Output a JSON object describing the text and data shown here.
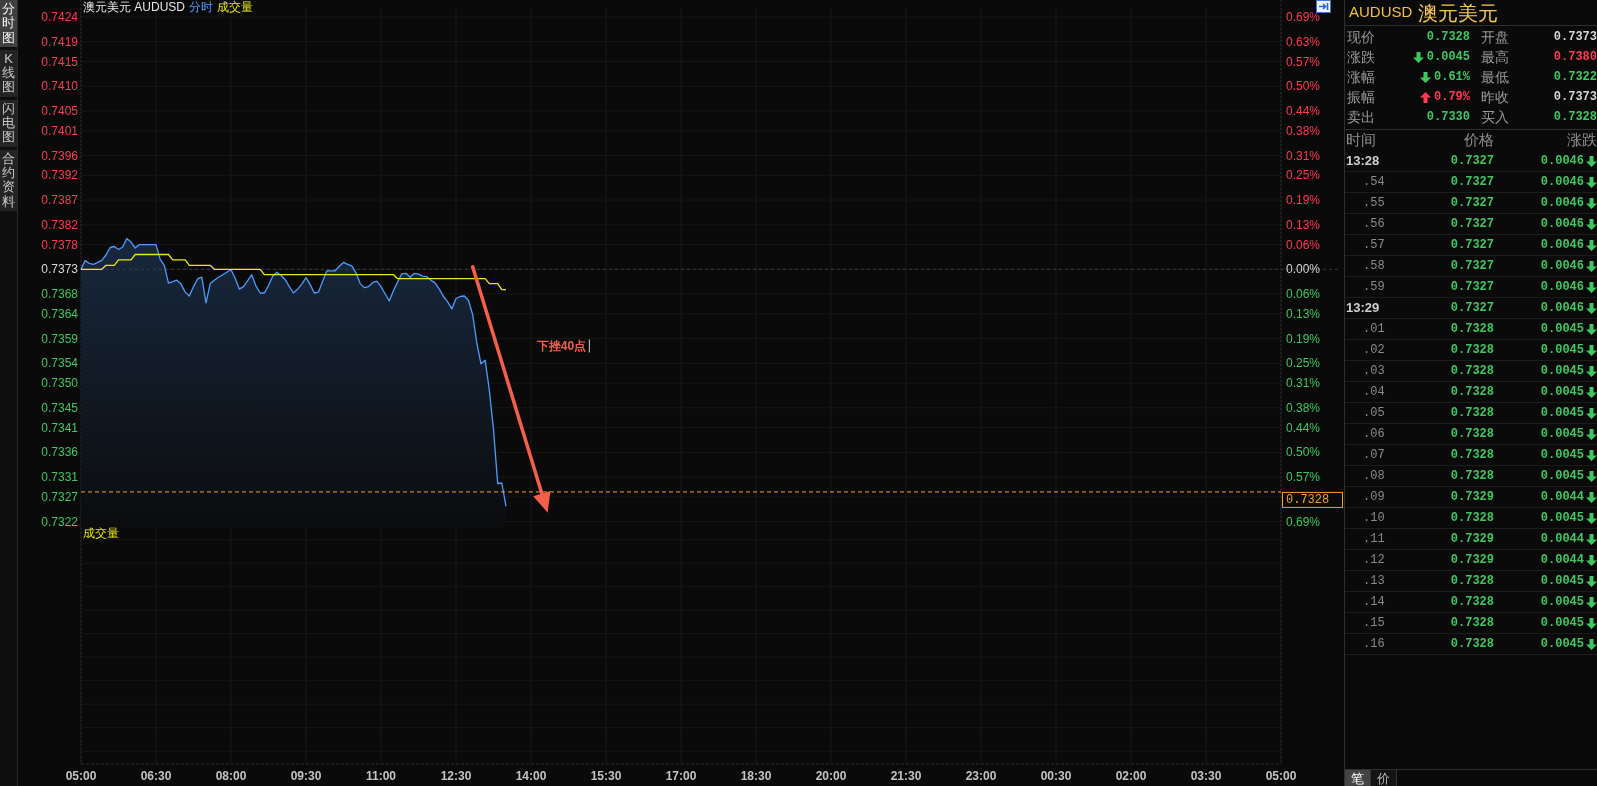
{
  "side_tabs": [
    {
      "label": "分时图",
      "selected": true
    },
    {
      "label": "K线图",
      "selected": false
    },
    {
      "label": "闪电图",
      "selected": false
    },
    {
      "label": "合约资料",
      "selected": false
    }
  ],
  "chart": {
    "chart_data": {
      "type": "line",
      "title": "澳元美元 AUDUSD",
      "grid": true,
      "categories": [
        "05:00",
        null,
        null,
        null,
        null,
        null,
        null,
        null,
        null,
        null,
        null,
        null,
        null,
        null,
        null,
        null,
        null,
        null,
        "06:30",
        null,
        null,
        null,
        null,
        null,
        null,
        null,
        null,
        null,
        null,
        null,
        null,
        null,
        null,
        null,
        null,
        null,
        "08:00",
        null,
        null,
        null,
        null,
        null,
        null,
        null,
        null,
        null,
        null,
        null,
        null,
        null,
        null,
        null,
        null,
        null,
        "09:30",
        null,
        null,
        null,
        null,
        null,
        null,
        null,
        null,
        null,
        null,
        null,
        null,
        null,
        null,
        null,
        null,
        null,
        "11:00",
        null,
        null,
        null,
        null,
        null,
        null,
        null,
        null,
        null,
        null,
        null,
        null,
        null,
        null,
        null,
        null,
        null,
        "12:30",
        null,
        null,
        null,
        null,
        null,
        null,
        null,
        null,
        null,
        null,
        null,
        null,
        null,
        null,
        null,
        null,
        null,
        "14:00",
        null,
        null,
        null,
        null,
        null,
        null,
        null,
        null,
        null,
        null,
        null,
        null,
        null,
        null,
        null,
        null,
        null,
        "15:30",
        null,
        null,
        null,
        null,
        null,
        null,
        null,
        null,
        null,
        null,
        null,
        null,
        null,
        null,
        null,
        null,
        null,
        "17:00",
        null,
        null,
        null,
        null,
        null,
        null,
        null,
        null,
        null,
        null,
        null,
        null,
        null,
        null,
        null,
        null,
        null,
        "18:30",
        null,
        null,
        null,
        null,
        null,
        null,
        null,
        null,
        null,
        null,
        null,
        null,
        null,
        null,
        null,
        null,
        null,
        "20:00",
        null,
        null,
        null,
        null,
        null,
        null,
        null,
        null,
        null,
        null,
        null,
        null,
        null,
        null,
        null,
        null,
        null,
        "21:30",
        null,
        null,
        null,
        null,
        null,
        null,
        null,
        null,
        null,
        null,
        null,
        null,
        null,
        null,
        null,
        null,
        null,
        "23:00",
        null,
        null,
        null,
        null,
        null,
        null,
        null,
        null,
        null,
        null,
        null,
        null,
        null,
        null,
        null,
        null,
        null,
        "00:30",
        null,
        null,
        null,
        null,
        null,
        null,
        null,
        null,
        null,
        null,
        null,
        null,
        null,
        null,
        null,
        null,
        null,
        "02:00",
        null,
        null,
        null,
        null,
        null,
        null,
        null,
        null,
        null,
        null,
        null,
        null,
        null,
        null,
        null,
        null,
        null,
        "03:30",
        null,
        null,
        null,
        null,
        null,
        null,
        null,
        null,
        null,
        null,
        null,
        null,
        null,
        null,
        null,
        null,
        null,
        "05:00"
      ],
      "series": [
        {
          "name": "分时",
          "color": "#4d9bff",
          "values": [
            0.7373,
            0.73748,
            0.73742,
            0.7374,
            0.73744,
            0.73748,
            0.73759,
            0.73774,
            0.73776,
            0.7377,
            0.73775,
            0.73792,
            0.73785,
            0.73773,
            0.7378,
            0.7378,
            0.7378,
            0.7378,
            0.7378,
            0.7375,
            0.73738,
            0.73702,
            0.73705,
            0.73708,
            0.737,
            0.73684,
            0.73676,
            0.73695,
            0.73711,
            0.73714,
            0.73662,
            0.73701,
            0.73708,
            0.73714,
            0.73719,
            0.73724,
            0.73729,
            0.73712,
            0.7369,
            0.73695,
            0.73707,
            0.73719,
            0.73696,
            0.73682,
            0.73682,
            0.73697,
            0.73716,
            0.73724,
            0.73718,
            0.73709,
            0.73695,
            0.73682,
            0.7369,
            0.737,
            0.73713,
            0.73699,
            0.73682,
            0.73684,
            0.73706,
            0.73727,
            0.73727,
            0.73727,
            0.73736,
            0.73744,
            0.7374,
            0.73737,
            0.73723,
            0.73701,
            0.73693,
            0.73695,
            0.73703,
            0.73706,
            0.73695,
            0.7368,
            0.73666,
            0.73687,
            0.73705,
            0.73721,
            0.73722,
            0.73714,
            0.73722,
            0.7372,
            0.73716,
            0.73715,
            0.73708,
            0.73702,
            0.7369,
            0.73675,
            0.73664,
            0.7365,
            0.73671,
            0.73675,
            0.73676,
            0.73667,
            0.73638,
            0.73581,
            0.73539,
            0.73546,
            0.73486,
            0.73406,
            0.73297,
            0.73298,
            0.73251,
            null,
            null,
            null,
            null,
            null,
            null,
            null,
            null,
            null,
            null,
            null,
            null,
            null,
            null,
            null,
            null,
            null,
            null,
            null,
            null,
            null,
            null,
            null,
            null,
            null,
            null,
            null,
            null,
            null,
            null,
            null,
            null,
            null,
            null,
            null,
            null,
            null,
            null,
            null,
            null,
            null,
            null,
            null,
            null,
            null,
            null,
            null,
            null,
            null,
            null,
            null,
            null,
            null,
            null,
            null,
            null,
            null,
            null,
            null,
            null,
            null,
            null,
            null,
            null,
            null,
            null,
            null,
            null,
            null,
            null,
            null,
            null,
            null,
            null,
            null,
            null,
            null,
            null,
            null,
            null,
            null,
            null,
            null,
            null,
            null,
            null,
            null,
            null,
            null,
            null,
            null,
            null,
            null,
            null,
            null,
            null,
            null,
            null,
            null,
            null,
            null,
            null,
            null,
            null,
            null,
            null,
            null,
            null,
            null,
            null,
            null,
            null,
            null,
            null,
            null,
            null,
            null,
            null,
            null,
            null,
            null,
            null,
            null,
            null,
            null,
            null,
            null,
            null,
            null,
            null,
            null,
            null,
            null,
            null,
            null,
            null,
            null,
            null,
            null,
            null,
            null,
            null,
            null,
            null,
            null,
            null,
            null,
            null,
            null,
            null,
            null,
            null,
            null,
            null,
            null,
            null,
            null,
            null,
            null,
            null,
            null,
            null,
            null,
            null,
            null,
            null,
            null,
            null,
            null,
            null,
            null,
            null,
            null,
            null,
            null,
            null,
            null,
            null,
            null,
            null,
            null,
            null,
            null,
            null,
            null,
            null
          ]
        },
        {
          "name": "成交量",
          "color": "#e8e81a",
          "values": [
            0.7373,
            0.7373,
            0.7373,
            0.7373,
            0.7373,
            0.7373,
            0.73738,
            0.73738,
            0.73738,
            0.73749,
            0.73749,
            0.73749,
            0.73749,
            0.7376,
            0.7376,
            0.7376,
            0.7376,
            0.7376,
            0.7376,
            0.7376,
            0.7376,
            0.7376,
            0.73749,
            0.73749,
            0.73749,
            0.73749,
            0.73738,
            0.73738,
            0.73738,
            0.73738,
            0.73738,
            0.73738,
            0.7373,
            0.7373,
            0.7373,
            0.7373,
            0.7373,
            0.7373,
            0.7373,
            0.7373,
            0.7373,
            0.7373,
            0.7373,
            0.7373,
            0.73719,
            0.73719,
            0.73719,
            0.73719,
            0.73719,
            0.73719,
            0.73719,
            0.73719,
            0.73719,
            0.73719,
            0.73719,
            0.73719,
            0.73719,
            0.73719,
            0.73719,
            0.73719,
            0.73719,
            0.73719,
            0.73719,
            0.73719,
            0.73719,
            0.73719,
            0.73719,
            0.73719,
            0.73719,
            0.73719,
            0.73719,
            0.73719,
            0.73719,
            0.73719,
            0.73719,
            0.73719,
            0.73711,
            0.73711,
            0.73711,
            0.73711,
            0.73711,
            0.73711,
            0.73711,
            0.73711,
            0.73711,
            0.73711,
            0.73711,
            0.73711,
            0.73711,
            0.73711,
            0.73711,
            0.73711,
            0.73711,
            0.73711,
            0.73711,
            0.73711,
            0.73711,
            0.73711,
            0.73701,
            0.73701,
            0.73701,
            0.73689,
            0.73689,
            null,
            null,
            null,
            null,
            null,
            null,
            null,
            null,
            null,
            null,
            null,
            null,
            null,
            null,
            null,
            null,
            null,
            null,
            null,
            null,
            null,
            null,
            null,
            null,
            null,
            null,
            null,
            null,
            null,
            null,
            null,
            null,
            null,
            null,
            null,
            null,
            null,
            null,
            null,
            null,
            null,
            null,
            null,
            null,
            null,
            null,
            null,
            null,
            null,
            null,
            null,
            null,
            null,
            null,
            null,
            null,
            null,
            null,
            null,
            null,
            null,
            null,
            null,
            null,
            null,
            null,
            null,
            null,
            null,
            null,
            null,
            null,
            null,
            null,
            null,
            null,
            null,
            null,
            null,
            null,
            null,
            null,
            null,
            null,
            null,
            null,
            null,
            null,
            null,
            null,
            null,
            null,
            null,
            null,
            null,
            null,
            null,
            null,
            null,
            null,
            null,
            null,
            null,
            null,
            null,
            null,
            null,
            null,
            null,
            null,
            null,
            null,
            null,
            null,
            null,
            null,
            null,
            null,
            null,
            null,
            null,
            null,
            null,
            null,
            null,
            null,
            null,
            null,
            null,
            null,
            null,
            null,
            null,
            null,
            null,
            null,
            null,
            null,
            null,
            null,
            null,
            null,
            null,
            null,
            null,
            null,
            null,
            null,
            null,
            null,
            null,
            null,
            null,
            null,
            null,
            null,
            null,
            null,
            null,
            null,
            null,
            null,
            null,
            null,
            null,
            null,
            null,
            null,
            null,
            null,
            null,
            null,
            null,
            null,
            null,
            null,
            null,
            null,
            null,
            null,
            null,
            null,
            null,
            null,
            null,
            null
          ]
        }
      ],
      "ylim": [
        0.7273,
        0.7424
      ],
      "yticks": [
        {
          "value": 0.7424,
          "label": "0.7424"
        },
        {
          "value": 0.7419,
          "label": "0.7419"
        },
        {
          "value": 0.7415,
          "label": "0.7415"
        },
        {
          "value": 0.741,
          "label": "0.7410"
        },
        {
          "value": 0.7405,
          "label": "0.7405"
        },
        {
          "value": 0.7401,
          "label": "0.7401"
        },
        {
          "value": 0.7396,
          "label": "0.7396"
        },
        {
          "value": 0.7392,
          "label": "0.7392"
        },
        {
          "value": 0.7387,
          "label": "0.7387"
        },
        {
          "value": 0.7382,
          "label": "0.7382"
        },
        {
          "value": 0.7378,
          "label": "0.7378"
        },
        {
          "value": 0.7373,
          "label": "0.7373"
        },
        {
          "value": 0.7368,
          "label": "0.7368"
        },
        {
          "value": 0.7364,
          "label": "0.7364"
        },
        {
          "value": 0.7359,
          "label": "0.7359"
        },
        {
          "value": 0.7354,
          "label": "0.7354"
        },
        {
          "value": 0.735,
          "label": "0.7350"
        },
        {
          "value": 0.7345,
          "label": "0.7345"
        },
        {
          "value": 0.7341,
          "label": "0.7341"
        },
        {
          "value": 0.7336,
          "label": "0.7336"
        },
        {
          "value": 0.7331,
          "label": "0.7331"
        },
        {
          "value": 0.7327,
          "label": "0.7327"
        },
        {
          "value": 0.7322,
          "label": "0.7322"
        }
      ],
      "ref_lines": [
        {
          "axis": "y",
          "value": 0.7373
        },
        {
          "axis": "y",
          "value": 0.7328,
          "label": "0.7328"
        }
      ],
      "annotations": [
        "下挫40点"
      ]
    },
    "percent_axis": [
      "0.69%",
      "0.63%",
      "0.57%",
      "0.50%",
      "0.44%",
      "0.38%",
      "0.31%",
      "0.25%",
      "0.19%",
      "0.13%",
      "0.06%",
      "0.00%",
      "0.06%",
      "0.13%",
      "0.19%",
      "0.25%",
      "0.31%",
      "0.38%",
      "0.44%",
      "0.50%",
      "0.57%",
      "0.69%"
    ],
    "volume_pane": {
      "title": "成交量"
    }
  },
  "quote_panel": {
    "symbol": "AUDUSD",
    "name": "澳元美元",
    "fields": [
      {
        "label": "现价",
        "value": "0.7328",
        "kind": "down",
        "arrow": false
      },
      {
        "label": "开盘",
        "value": "0.7373",
        "kind": "flat",
        "arrow": false
      },
      {
        "label": "涨跌",
        "value": "0.0045",
        "kind": "down",
        "arrow": true
      },
      {
        "label": "最高",
        "value": "0.7380",
        "kind": "up",
        "arrow": false
      },
      {
        "label": "涨幅",
        "value": "0.61%",
        "kind": "down",
        "arrow": true
      },
      {
        "label": "最低",
        "value": "0.7322",
        "kind": "down",
        "arrow": false
      },
      {
        "label": "振幅",
        "value": "0.79%",
        "kind": "up",
        "arrow": true
      },
      {
        "label": "昨收",
        "value": "0.7373",
        "kind": "flat",
        "arrow": false
      },
      {
        "label": "卖出",
        "value": "0.7330",
        "kind": "down",
        "arrow": false
      },
      {
        "label": "买入",
        "value": "0.7328",
        "kind": "down",
        "arrow": false
      }
    ]
  },
  "ticks_table": {
    "columns": [
      "时间",
      "价格",
      "涨跌"
    ],
    "rows": [
      {
        "time": "13:28",
        "kind": "minute",
        "price": "0.7327",
        "change": "0.0046",
        "falling": true
      },
      {
        "time": ".54",
        "kind": "second",
        "price": "0.7327",
        "change": "0.0046",
        "falling": true
      },
      {
        "time": ".55",
        "kind": "second",
        "price": "0.7327",
        "change": "0.0046",
        "falling": true
      },
      {
        "time": ".56",
        "kind": "second",
        "price": "0.7327",
        "change": "0.0046",
        "falling": true
      },
      {
        "time": ".57",
        "kind": "second",
        "price": "0.7327",
        "change": "0.0046",
        "falling": true
      },
      {
        "time": ".58",
        "kind": "second",
        "price": "0.7327",
        "change": "0.0046",
        "falling": true
      },
      {
        "time": ".59",
        "kind": "second",
        "price": "0.7327",
        "change": "0.0046",
        "falling": true
      },
      {
        "time": "13:29",
        "kind": "minute",
        "price": "0.7327",
        "change": "0.0046",
        "falling": true
      },
      {
        "time": ".01",
        "kind": "second",
        "price": "0.7328",
        "change": "0.0045",
        "falling": true
      },
      {
        "time": ".02",
        "kind": "second",
        "price": "0.7328",
        "change": "0.0045",
        "falling": true
      },
      {
        "time": ".03",
        "kind": "second",
        "price": "0.7328",
        "change": "0.0045",
        "falling": true
      },
      {
        "time": ".04",
        "kind": "second",
        "price": "0.7328",
        "change": "0.0045",
        "falling": true
      },
      {
        "time": ".05",
        "kind": "second",
        "price": "0.7328",
        "change": "0.0045",
        "falling": true
      },
      {
        "time": ".06",
        "kind": "second",
        "price": "0.7328",
        "change": "0.0045",
        "falling": true
      },
      {
        "time": ".07",
        "kind": "second",
        "price": "0.7328",
        "change": "0.0045",
        "falling": true
      },
      {
        "time": ".08",
        "kind": "second",
        "price": "0.7328",
        "change": "0.0045",
        "falling": true
      },
      {
        "time": ".09",
        "kind": "second",
        "price": "0.7329",
        "change": "0.0044",
        "falling": true
      },
      {
        "time": ".10",
        "kind": "second",
        "price": "0.7328",
        "change": "0.0045",
        "falling": true
      },
      {
        "time": ".11",
        "kind": "second",
        "price": "0.7329",
        "change": "0.0044",
        "falling": true
      },
      {
        "time": ".12",
        "kind": "second",
        "price": "0.7329",
        "change": "0.0044",
        "falling": true
      },
      {
        "time": ".13",
        "kind": "second",
        "price": "0.7328",
        "change": "0.0045",
        "falling": true
      },
      {
        "time": ".14",
        "kind": "second",
        "price": "0.7328",
        "change": "0.0045",
        "falling": true
      },
      {
        "time": ".15",
        "kind": "second",
        "price": "0.7328",
        "change": "0.0045",
        "falling": true
      },
      {
        "time": ".16",
        "kind": "second",
        "price": "0.7328",
        "change": "0.0045",
        "falling": true
      }
    ]
  },
  "bottom_tabs": [
    {
      "label": "笔",
      "selected": true
    },
    {
      "label": "价",
      "selected": false
    }
  ]
}
